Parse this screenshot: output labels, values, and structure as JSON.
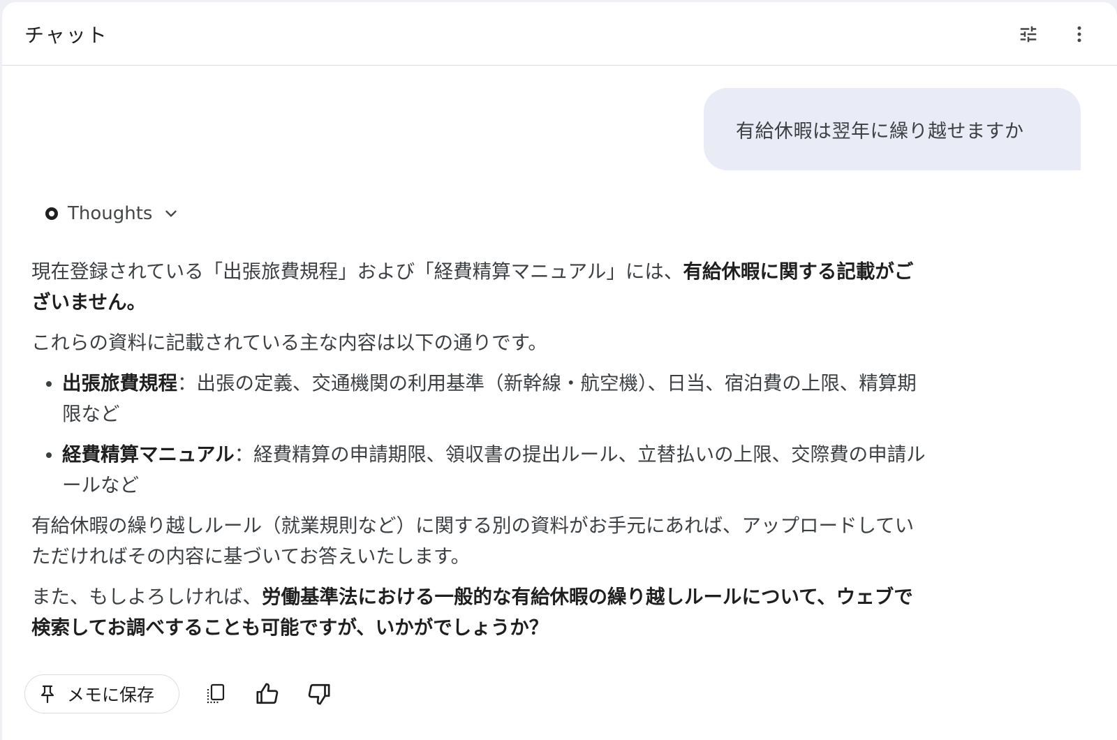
{
  "header": {
    "title": "チャット",
    "tune_icon": "tune-icon",
    "more_icon": "more-vert-icon"
  },
  "conversation": {
    "user_message": "有給休暇は翌年に繰り越せますか",
    "thoughts_label": "Thoughts",
    "answer": {
      "p1_normal": "現在登録されている「出張旅費規程」および「経費精算マニュアル」には、",
      "p1_bold": "有給休暇に関する記載がございません。",
      "p2": "これらの資料に記載されている主な内容は以下の通りです。",
      "bullets": [
        {
          "term": "出張旅費規程",
          "desc": "：出張の定義、交通機関の利用基準（新幹線・航空機）、日当、宿泊費の上限、精算期限など"
        },
        {
          "term": "経費精算マニュアル",
          "desc": "：経費精算の申請期限、領収書の提出ルール、立替払いの上限、交際費の申請ルールなど"
        }
      ],
      "p3": "有給休暇の繰り越しルール（就業規則など）に関する別の資料がお手元にあれば、アップロードしていただければその内容に基づいてお答えいたします。",
      "p4_normal": "また、もしよろしければ、",
      "p4_bold": "労働基準法における一般的な有給休暇の繰り越しルールについて、ウェブで検索してお調べすることも可能ですが、いかがでしょうか？"
    }
  },
  "actions": {
    "save_label": "メモに保存",
    "icons": [
      "pin-icon",
      "copy-icon",
      "thumb-up-icon",
      "thumb-down-icon"
    ]
  },
  "colors": {
    "user_bubble": "#e9ebf7",
    "border": "#dadce0",
    "text": "#1f1f1f",
    "secondary_text": "#3c4043"
  }
}
